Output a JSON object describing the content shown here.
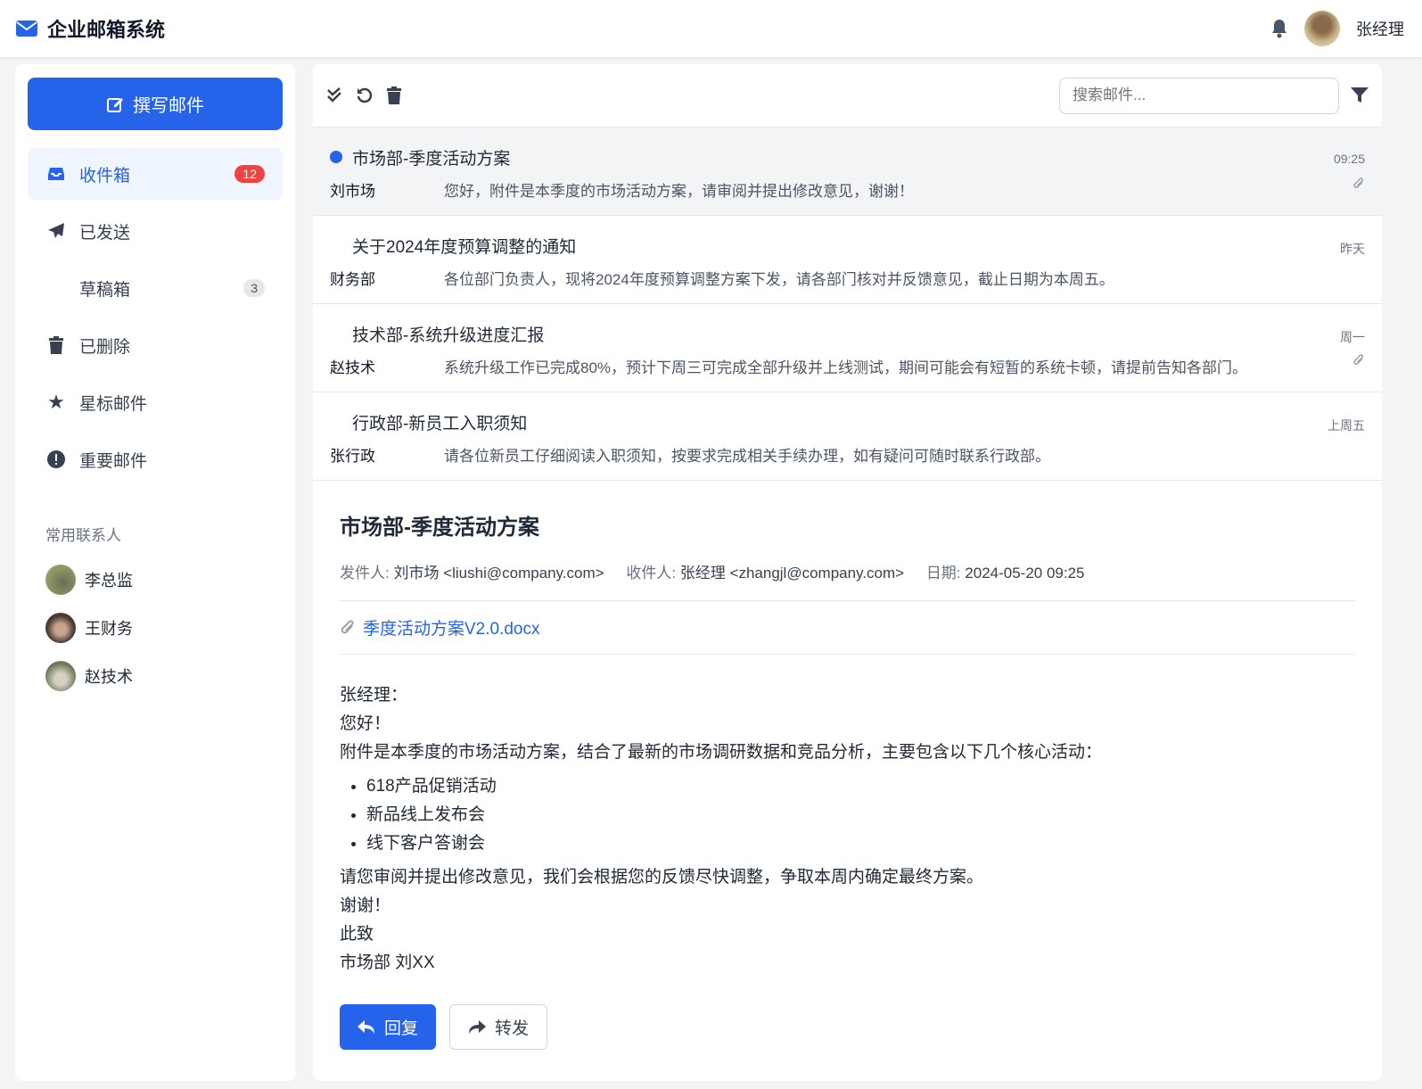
{
  "app": {
    "title": "企业邮箱系统",
    "user": "张经理"
  },
  "sidebar": {
    "compose": "撰写邮件",
    "items": [
      {
        "label": "收件箱",
        "badge": "12"
      },
      {
        "label": "已发送"
      },
      {
        "label": "草稿箱",
        "badge": "3"
      },
      {
        "label": "已删除"
      },
      {
        "label": "星标邮件"
      },
      {
        "label": "重要邮件"
      }
    ],
    "contacts_title": "常用联系人",
    "contacts": [
      "李总监",
      "王财务",
      "赵技术"
    ]
  },
  "toolbar": {
    "search_placeholder": "搜索邮件..."
  },
  "emails": [
    {
      "subject": "市场部-季度活动方案",
      "sender": "刘市场",
      "preview": "您好，附件是本季度的市场活动方案，请审阅并提出修改意见，谢谢！",
      "time": "09:25",
      "unread": true,
      "attachment": true
    },
    {
      "subject": "关于2024年度预算调整的通知",
      "sender": "财务部",
      "preview": "各位部门负责人，现将2024年度预算调整方案下发，请各部门核对并反馈意见，截止日期为本周五。",
      "time": "昨天"
    },
    {
      "subject": "技术部-系统升级进度汇报",
      "sender": "赵技术",
      "preview": "系统升级工作已完成80%，预计下周三可完成全部升级并上线测试，期间可能会有短暂的系统卡顿，请提前告知各部门。",
      "time": "周一",
      "attachment": true
    },
    {
      "subject": "行政部-新员工入职须知",
      "sender": "张行政",
      "preview": "请各位新员工仔细阅读入职须知，按要求完成相关手续办理，如有疑问可随时联系行政部。",
      "time": "上周五"
    }
  ],
  "detail": {
    "title": "市场部-季度活动方案",
    "from_label": "发件人:",
    "from": "刘市场 <liushi@company.com>",
    "to_label": "收件人:",
    "to": "张经理 <zhangjl@company.com>",
    "date_label": "日期:",
    "date": "2024-05-20 09:25",
    "attachment": "季度活动方案V2.0.docx",
    "greeting": "张经理：",
    "hello": "您好！",
    "intro": "附件是本季度的市场活动方案，结合了最新的市场调研数据和竞品分析，主要包含以下几个核心活动：",
    "bullets": [
      "618产品促销活动",
      "新品线上发布会",
      "线下客户答谢会"
    ],
    "closing": "请您审阅并提出修改意见，我们会根据您的反馈尽快调整，争取本周内确定最终方案。",
    "thanks": "谢谢！",
    "regards": "此致",
    "signature": "市场部 刘XX",
    "reply": "回复",
    "forward": "转发"
  }
}
